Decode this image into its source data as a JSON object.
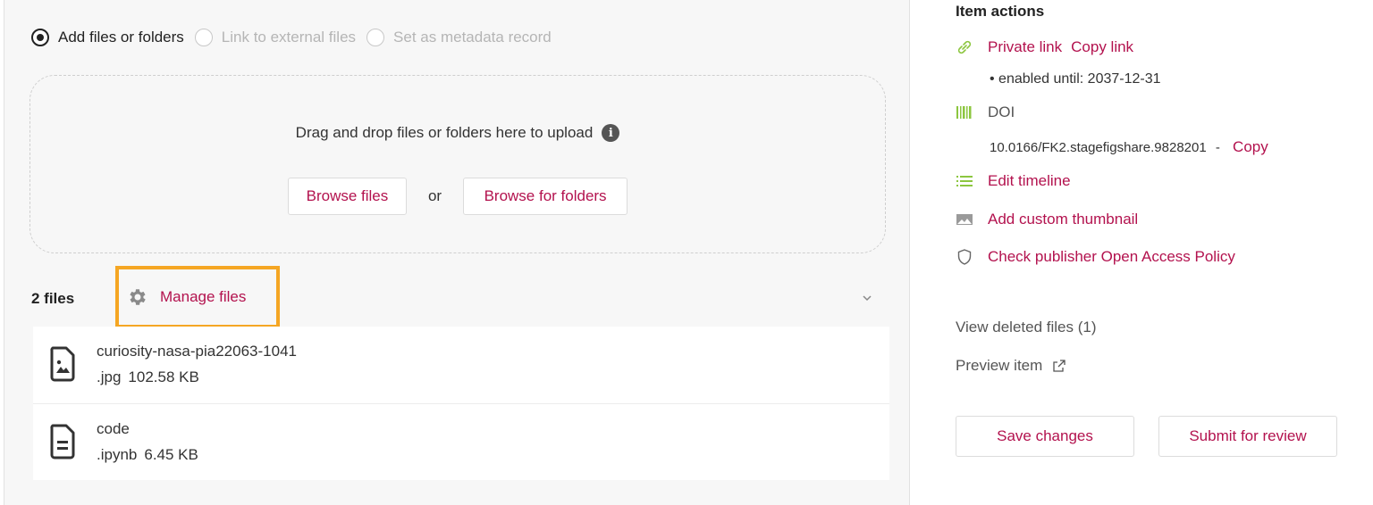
{
  "upload_options": {
    "add_files": "Add files or folders",
    "link_external": "Link to external files",
    "metadata_record": "Set as metadata record"
  },
  "dropzone": {
    "instruction": "Drag and drop files or folders here to upload",
    "browse_files": "Browse files",
    "or": "or",
    "browse_folders": "Browse for folders"
  },
  "files": {
    "count_label": "2 files",
    "manage_label": "Manage files",
    "items": [
      {
        "name": "curiosity-nasa-pia22063-1041",
        "ext": ".jpg",
        "size": "102.58 KB",
        "icon": "image-file-icon"
      },
      {
        "name": "code",
        "ext": ".ipynb",
        "size": "6.45 KB",
        "icon": "document-file-icon"
      }
    ]
  },
  "item_actions": {
    "title": "Item actions",
    "private_link": "Private link",
    "copy_link": "Copy link",
    "enabled_until": "• enabled until: 2037-12-31",
    "doi_label": "DOI",
    "doi_value": "10.0166/FK2.stagefigshare.9828201",
    "doi_sep": "-",
    "doi_copy": "Copy",
    "edit_timeline": "Edit timeline",
    "add_thumbnail": "Add custom thumbnail",
    "check_policy": "Check publisher Open Access Policy",
    "view_deleted": "View deleted files (1)",
    "preview_item": "Preview item",
    "save_changes": "Save changes",
    "submit_review": "Submit for review"
  },
  "colors": {
    "link": "#b3124e",
    "highlight": "#f5a623",
    "icon_green": "#8cc63f"
  }
}
